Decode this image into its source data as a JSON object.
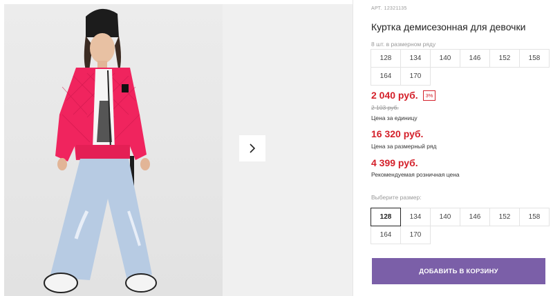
{
  "product": {
    "article_label": "АРТ.",
    "article_value": "12321135",
    "title": "Куртка демисезонная для девочки"
  },
  "size_row": {
    "label": "8 шт. в размерном ряду",
    "sizes": [
      "128",
      "134",
      "140",
      "146",
      "152",
      "158",
      "164",
      "170"
    ]
  },
  "pricing": {
    "unit_price": "2 040 руб.",
    "discount": "3%",
    "old_price": "2 103 руб.",
    "unit_caption": "Цена за единицу",
    "row_price": "16 320 руб.",
    "row_caption": "Цена за размерный ряд",
    "retail_price": "4 399 руб.",
    "retail_caption": "Рекомендуемая розничная цена"
  },
  "size_select": {
    "label": "Выберите размер:",
    "sizes": [
      "128",
      "134",
      "140",
      "146",
      "152",
      "158",
      "164",
      "170"
    ],
    "selected": "128"
  },
  "actions": {
    "add_to_cart": "ДОБАВИТЬ В КОРЗИНУ"
  },
  "colors": {
    "price_red": "#d4202a",
    "button_purple": "#7b5fa8",
    "jacket_pink": "#f0245e"
  },
  "icons": {
    "next": "chevron-right-icon"
  }
}
